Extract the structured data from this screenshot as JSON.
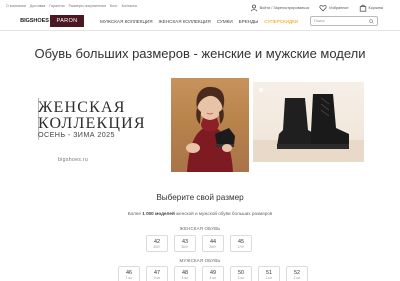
{
  "topbar": {
    "links": [
      "О компании",
      "Доставка",
      "Гарантии",
      "Размеры покупателям",
      "Блог",
      "Контакты"
    ]
  },
  "logo": {
    "part_a": "BIGSHOES",
    "part_b": "PARON"
  },
  "menu": {
    "items": [
      "МУЖСКАЯ КОЛЛЕКЦИЯ",
      "ЖЕНСКАЯ КОЛЛЕКЦИЯ",
      "СУМКИ",
      "БРЕНДЫ"
    ],
    "sale": "СУПЕРСКИДКИ"
  },
  "user_area": {
    "login": "Войти / Зарегистрироваться",
    "favorites": "Избранное",
    "cart": "Корзина"
  },
  "search": {
    "placeholder": "Поиск"
  },
  "page_title": "Обувь больших размеров - женские и мужские модели",
  "banner": {
    "title_line1": "ЖЕНСКАЯ",
    "title_line2": "КОЛЛЕКЦИЯ",
    "subtitle": "ОСЕНЬ - ЗИМА 2025",
    "url": "bigshoes.ru"
  },
  "size_section": {
    "title": "Выберите свой размер",
    "desc_prefix": "Более ",
    "desc_bold": "1 000 моделей",
    "desc_suffix": " женской и мужской обуви больших размеров",
    "women_label": "ЖЕНСКАЯ ОБУВЬ",
    "women_sizes": [
      {
        "n": "42",
        "c": "450+"
      },
      {
        "n": "43",
        "c": "360+"
      },
      {
        "n": "44",
        "c": "280+"
      },
      {
        "n": "45",
        "c": "170+"
      }
    ],
    "men_label": "МУЖСКАЯ ОБУВЬ",
    "men_sizes": [
      {
        "n": "46",
        "c": "7 шт"
      },
      {
        "n": "47",
        "c": "9 шт"
      },
      {
        "n": "48",
        "c": "5 шт"
      },
      {
        "n": "49",
        "c": "4 шт"
      },
      {
        "n": "50",
        "c": "3 шт"
      },
      {
        "n": "51",
        "c": "2 шт"
      },
      {
        "n": "52",
        "c": "2 шт"
      }
    ]
  },
  "colors": {
    "brand": "#4a1722",
    "sale": "#e8a000"
  }
}
